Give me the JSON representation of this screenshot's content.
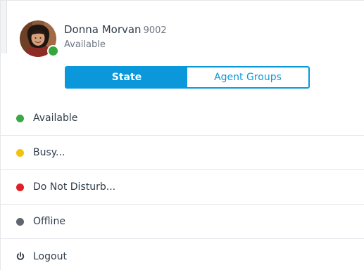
{
  "user": {
    "name": "Donna Morvan",
    "extension": "9002",
    "status": "Available",
    "avatar_icon": "user-avatar-photo",
    "presence_color": "#35a63a"
  },
  "tabs": [
    {
      "label": "State",
      "active": true
    },
    {
      "label": "Agent Groups",
      "active": false
    }
  ],
  "menu": {
    "items": [
      {
        "label": "Available",
        "color": "#3aa845",
        "icon": "status-dot-green"
      },
      {
        "label": "Busy...",
        "color": "#f3c20c",
        "icon": "status-dot-yellow"
      },
      {
        "label": "Do Not Disturb...",
        "color": "#df2027",
        "icon": "status-dot-red"
      },
      {
        "label": "Offline",
        "color": "#5f6670",
        "icon": "status-dot-gray"
      }
    ],
    "logout": {
      "label": "Logout",
      "icon": "power-icon"
    }
  },
  "colors": {
    "accent": "#0a98db",
    "text": "#2f3d4a",
    "muted": "#6e7782",
    "divider": "#e3e6e9"
  }
}
